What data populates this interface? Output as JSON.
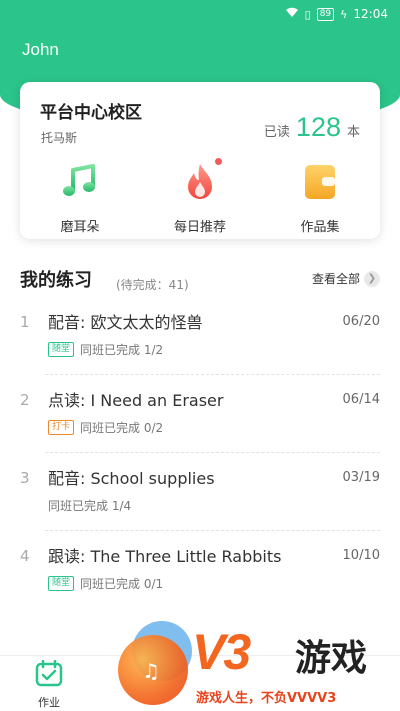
{
  "status_bar": {
    "battery": "89",
    "time": "12:04"
  },
  "header": {
    "username": "John"
  },
  "school_card": {
    "name": "平台中心校区",
    "teacher": "托马斯",
    "read_label": "已读",
    "read_count": "128",
    "read_unit": "本"
  },
  "features": [
    {
      "label": "磨耳朵",
      "icon": "music-note-icon"
    },
    {
      "label": "每日推荐",
      "icon": "flame-icon"
    },
    {
      "label": "作品集",
      "icon": "wallet-icon"
    }
  ],
  "practice": {
    "title": "我的练习",
    "pending": "(待完成：41)",
    "view_all": "查看全部"
  },
  "items": [
    {
      "index": "1",
      "title": "配音: 欧文太太的怪兽",
      "date": "06/20",
      "tag": "随堂",
      "progress": "同班已完成 1/2"
    },
    {
      "index": "2",
      "title": "点读: I Need an Eraser",
      "date": "06/14",
      "tag": "打卡",
      "progress": "同班已完成 0/2"
    },
    {
      "index": "3",
      "title": "配音: School supplies",
      "date": "03/19",
      "tag": "",
      "progress": "同班已完成 1/4"
    },
    {
      "index": "4",
      "title": "跟读: The Three Little Rabbits",
      "date": "10/10",
      "tag": "随堂",
      "progress": "同班已完成 0/1"
    }
  ],
  "tabbar": {
    "homework_label": "作业"
  },
  "watermark": {
    "brand": "V3",
    "game": "游戏",
    "slogan": "游戏人生，不负VVVV3"
  },
  "colors": {
    "accent": "#2bc48a",
    "tag_orange": "#f0882c",
    "brand_orange": "#f2661f"
  }
}
